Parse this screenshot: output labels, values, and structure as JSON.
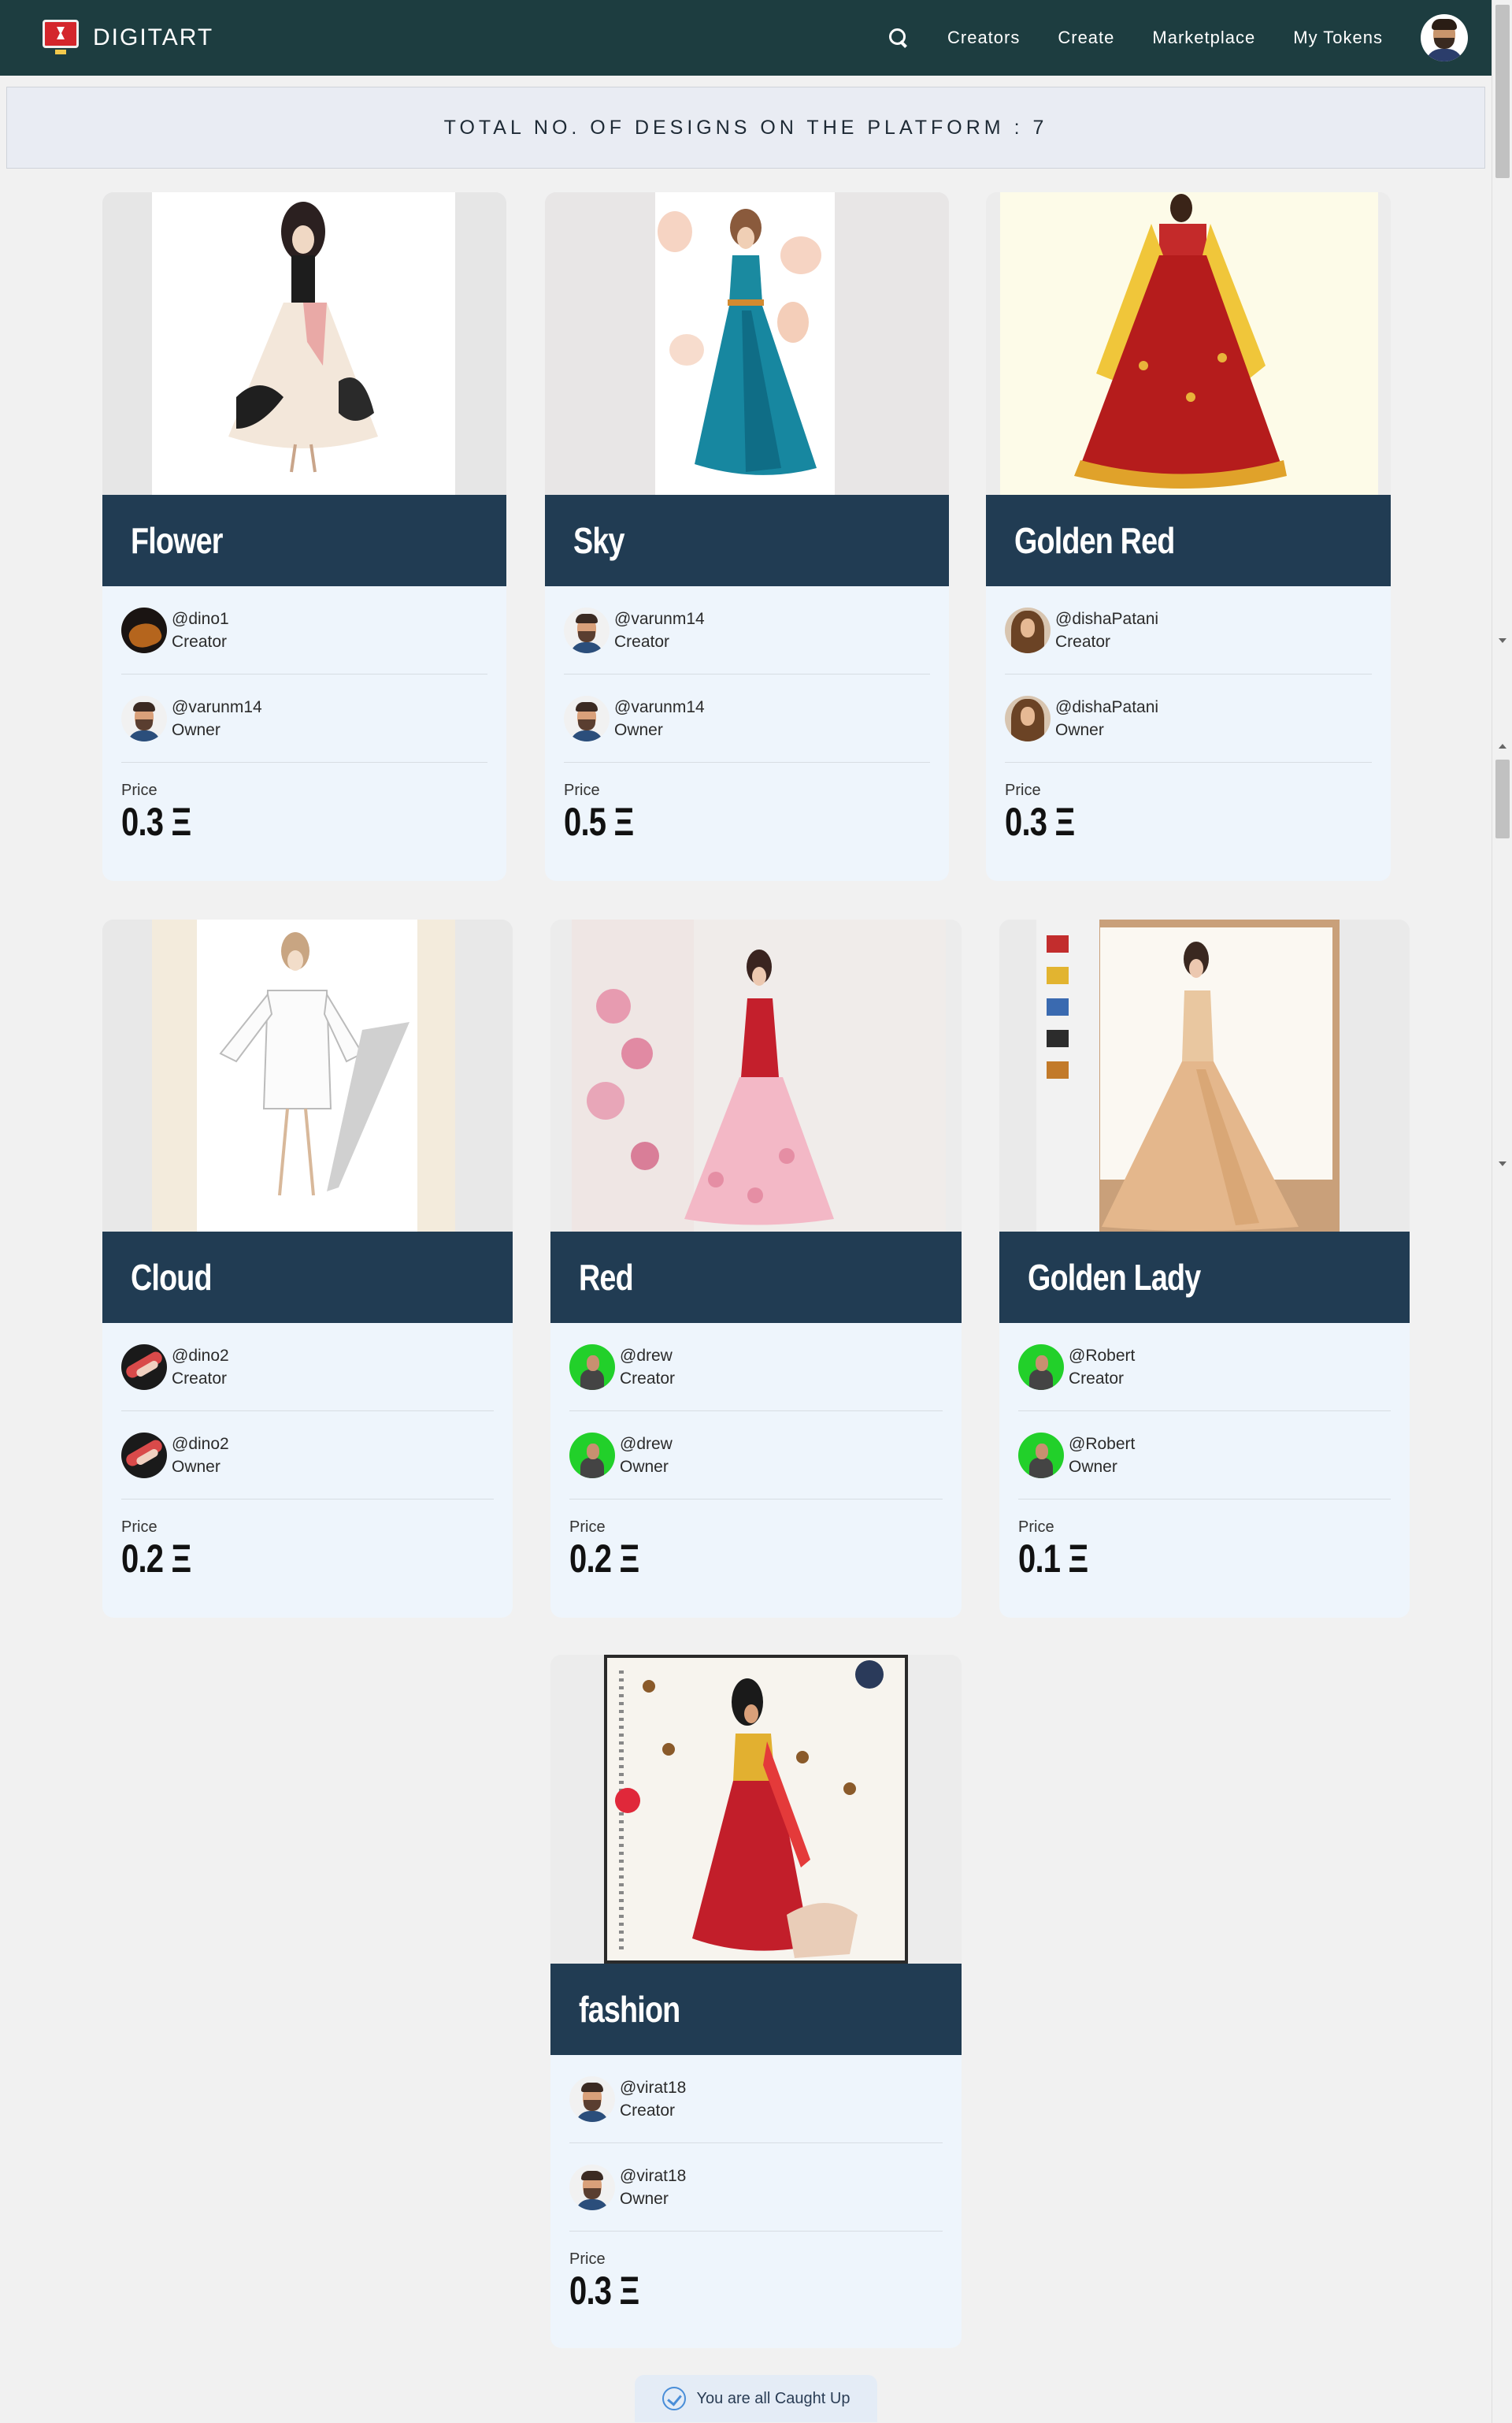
{
  "navbar": {
    "brand": "DIGITART",
    "links": [
      "Creators",
      "Create",
      "Marketplace",
      "My Tokens"
    ]
  },
  "banner": {
    "text": "TOTAL NO. OF DESIGNS ON THE PLATFORM : 7"
  },
  "cards": [
    {
      "title": "Flower",
      "creator": "@dino1",
      "creator_role": "Creator",
      "owner": "@varunm14",
      "owner_role": "Owner",
      "price_label": "Price",
      "price": "0.3 Ξ"
    },
    {
      "title": "Sky",
      "creator": "@varunm14",
      "creator_role": "Creator",
      "owner": "@varunm14",
      "owner_role": "Owner",
      "price_label": "Price",
      "price": "0.5 Ξ"
    },
    {
      "title": "Golden Red",
      "creator": "@dishaPatani",
      "creator_role": "Creator",
      "owner": "@dishaPatani",
      "owner_role": "Owner",
      "price_label": "Price",
      "price": "0.3 Ξ"
    },
    {
      "title": "Cloud",
      "creator": "@dino2",
      "creator_role": "Creator",
      "owner": "@dino2",
      "owner_role": "Owner",
      "price_label": "Price",
      "price": "0.2 Ξ"
    },
    {
      "title": "Red",
      "creator": "@drew",
      "creator_role": "Creator",
      "owner": "@drew",
      "owner_role": "Owner",
      "price_label": "Price",
      "price": "0.2 Ξ"
    },
    {
      "title": "Golden Lady",
      "creator": "@Robert",
      "creator_role": "Creator",
      "owner": "@Robert",
      "owner_role": "Owner",
      "price_label": "Price",
      "price": "0.1 Ξ"
    },
    {
      "title": "fashion",
      "creator": "@virat18",
      "creator_role": "Creator",
      "owner": "@virat18",
      "owner_role": "Owner",
      "price_label": "Price",
      "price": "0.3 Ξ"
    }
  ],
  "footer": {
    "caught_up": "You are all Caught Up"
  },
  "colors": {
    "navbar": "#1d3d40",
    "card_title_bar": "#213c53",
    "card_body": "#eef5fc"
  }
}
